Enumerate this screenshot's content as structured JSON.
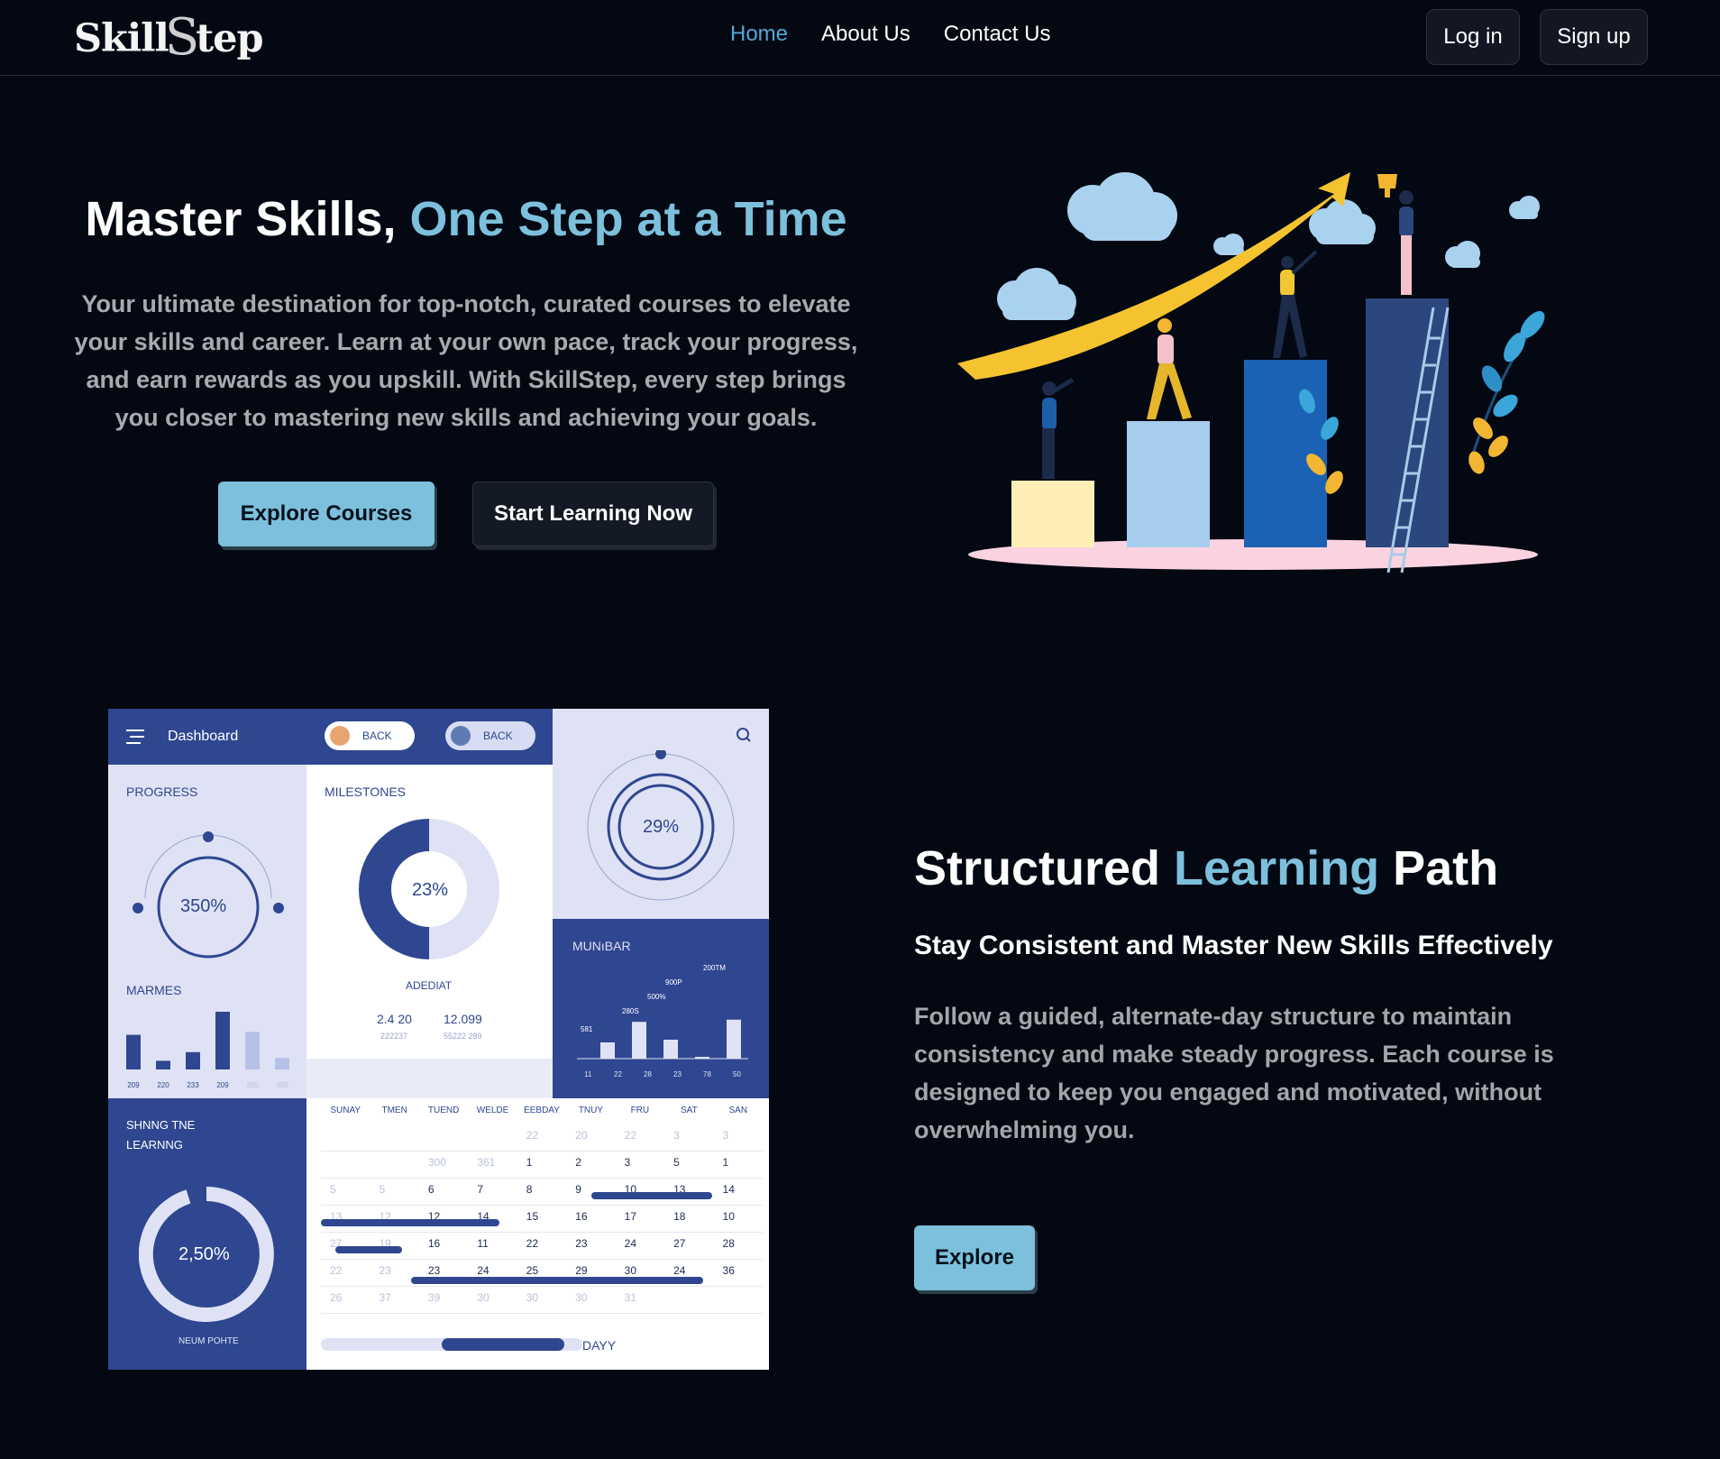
{
  "brand": {
    "logo_left": "Skill",
    "logo_s": "S",
    "logo_right": "tep"
  },
  "nav": {
    "links": [
      {
        "label": "Home",
        "active": true
      },
      {
        "label": "About Us",
        "active": false
      },
      {
        "label": "Contact Us",
        "active": false
      }
    ],
    "login": "Log in",
    "signup": "Sign up"
  },
  "hero": {
    "title_main": "Master Skills, ",
    "title_accent": "One Step at a Time",
    "description": "Your ultimate destination for top-notch, curated courses to elevate your skills and career. Learn at your own pace, track your progress, and earn rewards as you upskill. With SkillStep, every step brings you closer to mastering new skills and achieving your goals.",
    "btn_primary": "Explore Courses",
    "btn_secondary": "Start Learning Now"
  },
  "dashboard": {
    "header_title": "Dashboard",
    "chip1": "BACK",
    "chip2": "BACK",
    "progress_label": "PROGRESS",
    "progress_value": "350%",
    "milestones_label": "MILESTONES",
    "milestones_value": "23%",
    "milestones_caption": "ADEDIAT",
    "stat1": "2.4 20",
    "stat1_sub": "222237",
    "stat2": "12.099",
    "stat2_sub": "55222 289",
    "top_right_value": "29%",
    "marmes_label": "MARMES",
    "marmes_ticks": [
      "209",
      "220",
      "233",
      "209",
      "255",
      "455"
    ],
    "marmes_values": [
      0.6,
      0.15,
      0.3,
      1.0,
      0.65,
      0.2
    ],
    "munibar_label": "MUNıBAR",
    "munibar_annotations": [
      "200TM",
      "900P",
      "500%",
      "280S",
      "581"
    ],
    "munibar_ticks": [
      "11",
      "22",
      "28",
      "23",
      "78",
      "50"
    ],
    "munibar_values": [
      0.3,
      0.68,
      0.35,
      0.02,
      0.72
    ],
    "shining_label_1": "SHNNG TNE",
    "shining_label_2": "LEARNNG",
    "shining_value": "2,50%",
    "shining_caption": "NEUM POHTE",
    "calendar_days": [
      "SUNAY",
      "TMEN",
      "TUEND",
      "WELDE",
      "EEBDAY",
      "TNUY",
      "FRU",
      "SAT",
      "SAN"
    ],
    "calendar_rows": [
      [
        "",
        "",
        "",
        "",
        "22",
        "20",
        "22",
        "3",
        "3"
      ],
      [
        "",
        "",
        "300",
        "361",
        "1",
        "2",
        "3",
        "5",
        "1"
      ],
      [
        "5",
        "5",
        "6",
        "7",
        "8",
        "9",
        "10",
        "13",
        "14"
      ],
      [
        "13",
        "12",
        "12",
        "14",
        "15",
        "16",
        "17",
        "18",
        "10"
      ],
      [
        "27",
        "19",
        "16",
        "11",
        "22",
        "23",
        "24",
        "27",
        "28"
      ],
      [
        "22",
        "23",
        "23",
        "24",
        "25",
        "29",
        "30",
        "24",
        "36"
      ],
      [
        "26",
        "37",
        "39",
        "30",
        "30",
        "30",
        "31",
        "",
        ""
      ]
    ],
    "footer_label": "DAYY"
  },
  "section2": {
    "title_1": "Structured ",
    "title_accent": "Learning",
    "title_2": " Path",
    "subtitle": "Stay Consistent and Master New Skills Effectively",
    "description": "Follow a guided, alternate-day structure to maintain consistency and make steady progress. Each course is designed to keep you engaged and motivated, without overwhelming you.",
    "btn": "Explore"
  },
  "colors": {
    "background": "#040812",
    "accent": "#7cc0dc",
    "nav_active": "#53a8d6",
    "dash_navy": "#2f4790"
  }
}
